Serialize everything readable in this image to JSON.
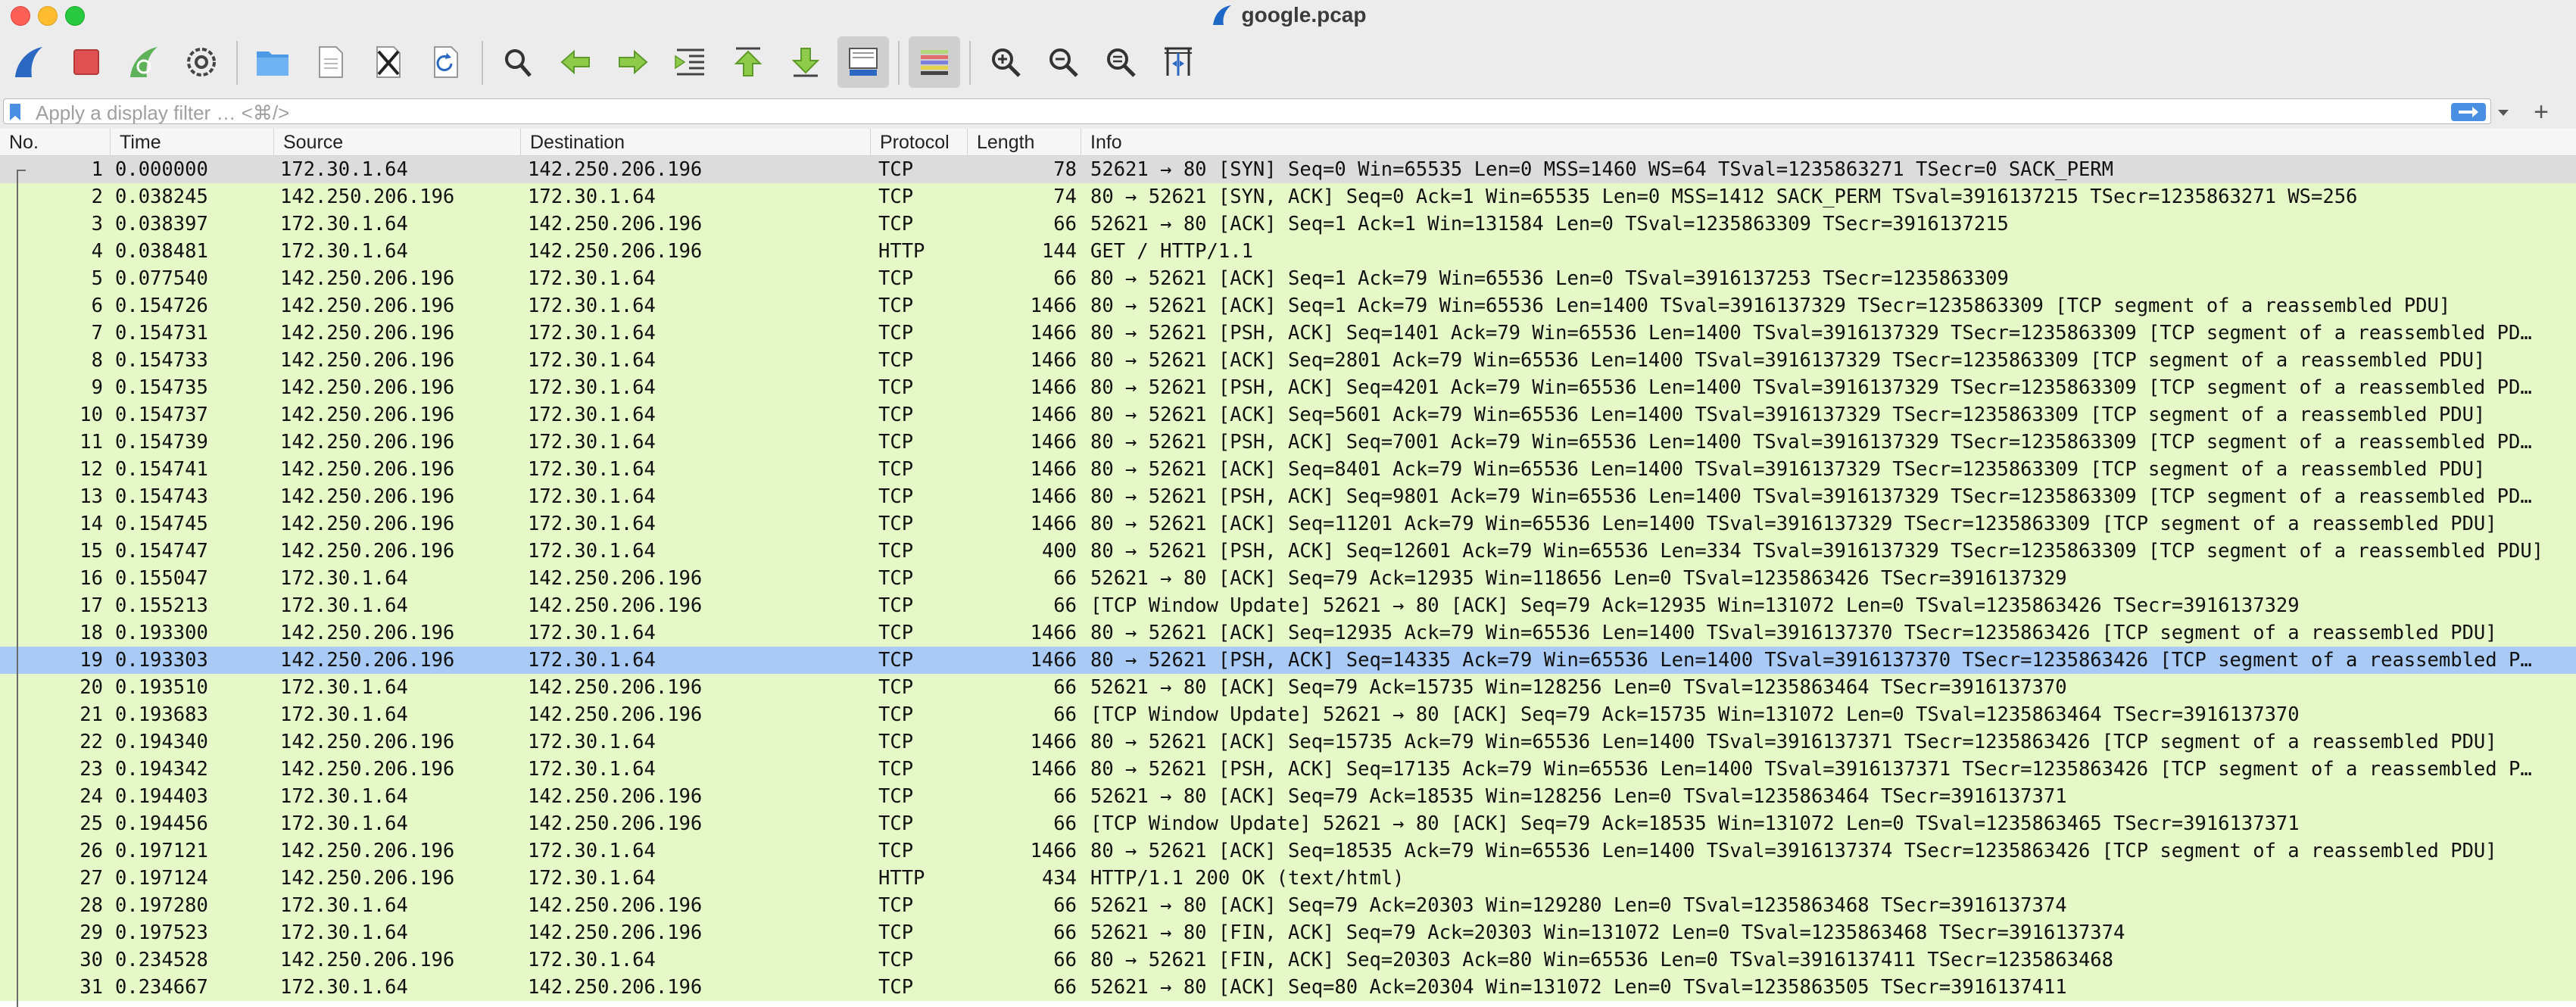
{
  "window": {
    "title": "google.pcap"
  },
  "toolbar": {
    "buttons": [
      {
        "name": "start-capture-icon"
      },
      {
        "name": "stop-capture-icon"
      },
      {
        "name": "restart-capture-icon"
      },
      {
        "name": "capture-options-icon"
      },
      {
        "name": "open-file-icon"
      },
      {
        "name": "save-file-icon"
      },
      {
        "name": "close-file-icon"
      },
      {
        "name": "reload-file-icon"
      },
      {
        "name": "find-packet-icon"
      },
      {
        "name": "go-back-icon"
      },
      {
        "name": "go-forward-icon"
      },
      {
        "name": "go-to-packet-icon"
      },
      {
        "name": "go-first-packet-icon"
      },
      {
        "name": "go-last-packet-icon"
      },
      {
        "name": "autoscroll-icon"
      },
      {
        "name": "colorize-icon"
      },
      {
        "name": "zoom-in-icon"
      },
      {
        "name": "zoom-out-icon"
      },
      {
        "name": "normal-size-icon"
      },
      {
        "name": "resize-columns-icon"
      }
    ]
  },
  "filter": {
    "placeholder": "Apply a display filter … <⌘/>"
  },
  "columns": {
    "no": "No.",
    "time": "Time",
    "source": "Source",
    "destination": "Destination",
    "protocol": "Protocol",
    "length": "Length",
    "info": "Info"
  },
  "packets": [
    {
      "no": "1",
      "time": "0.000000",
      "src": "172.30.1.64",
      "dst": "142.250.206.196",
      "proto": "TCP",
      "len": "78",
      "info": "52621 → 80 [SYN] Seq=0 Win=65535 Len=0 MSS=1460 WS=64 TSval=1235863271 TSecr=0 SACK_PERM"
    },
    {
      "no": "2",
      "time": "0.038245",
      "src": "142.250.206.196",
      "dst": "172.30.1.64",
      "proto": "TCP",
      "len": "74",
      "info": "80 → 52621 [SYN, ACK] Seq=0 Ack=1 Win=65535 Len=0 MSS=1412 SACK_PERM TSval=3916137215 TSecr=1235863271 WS=256"
    },
    {
      "no": "3",
      "time": "0.038397",
      "src": "172.30.1.64",
      "dst": "142.250.206.196",
      "proto": "TCP",
      "len": "66",
      "info": "52621 → 80 [ACK] Seq=1 Ack=1 Win=131584 Len=0 TSval=1235863309 TSecr=3916137215"
    },
    {
      "no": "4",
      "time": "0.038481",
      "src": "172.30.1.64",
      "dst": "142.250.206.196",
      "proto": "HTTP",
      "len": "144",
      "info": "GET / HTTP/1.1"
    },
    {
      "no": "5",
      "time": "0.077540",
      "src": "142.250.206.196",
      "dst": "172.30.1.64",
      "proto": "TCP",
      "len": "66",
      "info": "80 → 52621 [ACK] Seq=1 Ack=79 Win=65536 Len=0 TSval=3916137253 TSecr=1235863309"
    },
    {
      "no": "6",
      "time": "0.154726",
      "src": "142.250.206.196",
      "dst": "172.30.1.64",
      "proto": "TCP",
      "len": "1466",
      "info": "80 → 52621 [ACK] Seq=1 Ack=79 Win=65536 Len=1400 TSval=3916137329 TSecr=1235863309 [TCP segment of a reassembled PDU]"
    },
    {
      "no": "7",
      "time": "0.154731",
      "src": "142.250.206.196",
      "dst": "172.30.1.64",
      "proto": "TCP",
      "len": "1466",
      "info": "80 → 52621 [PSH, ACK] Seq=1401 Ack=79 Win=65536 Len=1400 TSval=3916137329 TSecr=1235863309 [TCP segment of a reassembled PD…"
    },
    {
      "no": "8",
      "time": "0.154733",
      "src": "142.250.206.196",
      "dst": "172.30.1.64",
      "proto": "TCP",
      "len": "1466",
      "info": "80 → 52621 [ACK] Seq=2801 Ack=79 Win=65536 Len=1400 TSval=3916137329 TSecr=1235863309 [TCP segment of a reassembled PDU]"
    },
    {
      "no": "9",
      "time": "0.154735",
      "src": "142.250.206.196",
      "dst": "172.30.1.64",
      "proto": "TCP",
      "len": "1466",
      "info": "80 → 52621 [PSH, ACK] Seq=4201 Ack=79 Win=65536 Len=1400 TSval=3916137329 TSecr=1235863309 [TCP segment of a reassembled PD…"
    },
    {
      "no": "10",
      "time": "0.154737",
      "src": "142.250.206.196",
      "dst": "172.30.1.64",
      "proto": "TCP",
      "len": "1466",
      "info": "80 → 52621 [ACK] Seq=5601 Ack=79 Win=65536 Len=1400 TSval=3916137329 TSecr=1235863309 [TCP segment of a reassembled PDU]"
    },
    {
      "no": "11",
      "time": "0.154739",
      "src": "142.250.206.196",
      "dst": "172.30.1.64",
      "proto": "TCP",
      "len": "1466",
      "info": "80 → 52621 [PSH, ACK] Seq=7001 Ack=79 Win=65536 Len=1400 TSval=3916137329 TSecr=1235863309 [TCP segment of a reassembled PD…"
    },
    {
      "no": "12",
      "time": "0.154741",
      "src": "142.250.206.196",
      "dst": "172.30.1.64",
      "proto": "TCP",
      "len": "1466",
      "info": "80 → 52621 [ACK] Seq=8401 Ack=79 Win=65536 Len=1400 TSval=3916137329 TSecr=1235863309 [TCP segment of a reassembled PDU]"
    },
    {
      "no": "13",
      "time": "0.154743",
      "src": "142.250.206.196",
      "dst": "172.30.1.64",
      "proto": "TCP",
      "len": "1466",
      "info": "80 → 52621 [PSH, ACK] Seq=9801 Ack=79 Win=65536 Len=1400 TSval=3916137329 TSecr=1235863309 [TCP segment of a reassembled PD…"
    },
    {
      "no": "14",
      "time": "0.154745",
      "src": "142.250.206.196",
      "dst": "172.30.1.64",
      "proto": "TCP",
      "len": "1466",
      "info": "80 → 52621 [ACK] Seq=11201 Ack=79 Win=65536 Len=1400 TSval=3916137329 TSecr=1235863309 [TCP segment of a reassembled PDU]"
    },
    {
      "no": "15",
      "time": "0.154747",
      "src": "142.250.206.196",
      "dst": "172.30.1.64",
      "proto": "TCP",
      "len": "400",
      "info": "80 → 52621 [PSH, ACK] Seq=12601 Ack=79 Win=65536 Len=334 TSval=3916137329 TSecr=1235863309 [TCP segment of a reassembled PDU]"
    },
    {
      "no": "16",
      "time": "0.155047",
      "src": "172.30.1.64",
      "dst": "142.250.206.196",
      "proto": "TCP",
      "len": "66",
      "info": "52621 → 80 [ACK] Seq=79 Ack=12935 Win=118656 Len=0 TSval=1235863426 TSecr=3916137329"
    },
    {
      "no": "17",
      "time": "0.155213",
      "src": "172.30.1.64",
      "dst": "142.250.206.196",
      "proto": "TCP",
      "len": "66",
      "info": "[TCP Window Update] 52621 → 80 [ACK] Seq=79 Ack=12935 Win=131072 Len=0 TSval=1235863426 TSecr=3916137329"
    },
    {
      "no": "18",
      "time": "0.193300",
      "src": "142.250.206.196",
      "dst": "172.30.1.64",
      "proto": "TCP",
      "len": "1466",
      "info": "80 → 52621 [ACK] Seq=12935 Ack=79 Win=65536 Len=1400 TSval=3916137370 TSecr=1235863426 [TCP segment of a reassembled PDU]"
    },
    {
      "no": "19",
      "time": "0.193303",
      "src": "142.250.206.196",
      "dst": "172.30.1.64",
      "proto": "TCP",
      "len": "1466",
      "info": "80 → 52621 [PSH, ACK] Seq=14335 Ack=79 Win=65536 Len=1400 TSval=3916137370 TSecr=1235863426 [TCP segment of a reassembled P…"
    },
    {
      "no": "20",
      "time": "0.193510",
      "src": "172.30.1.64",
      "dst": "142.250.206.196",
      "proto": "TCP",
      "len": "66",
      "info": "52621 → 80 [ACK] Seq=79 Ack=15735 Win=128256 Len=0 TSval=1235863464 TSecr=3916137370"
    },
    {
      "no": "21",
      "time": "0.193683",
      "src": "172.30.1.64",
      "dst": "142.250.206.196",
      "proto": "TCP",
      "len": "66",
      "info": "[TCP Window Update] 52621 → 80 [ACK] Seq=79 Ack=15735 Win=131072 Len=0 TSval=1235863464 TSecr=3916137370"
    },
    {
      "no": "22",
      "time": "0.194340",
      "src": "142.250.206.196",
      "dst": "172.30.1.64",
      "proto": "TCP",
      "len": "1466",
      "info": "80 → 52621 [ACK] Seq=15735 Ack=79 Win=65536 Len=1400 TSval=3916137371 TSecr=1235863426 [TCP segment of a reassembled PDU]"
    },
    {
      "no": "23",
      "time": "0.194342",
      "src": "142.250.206.196",
      "dst": "172.30.1.64",
      "proto": "TCP",
      "len": "1466",
      "info": "80 → 52621 [PSH, ACK] Seq=17135 Ack=79 Win=65536 Len=1400 TSval=3916137371 TSecr=1235863426 [TCP segment of a reassembled P…"
    },
    {
      "no": "24",
      "time": "0.194403",
      "src": "172.30.1.64",
      "dst": "142.250.206.196",
      "proto": "TCP",
      "len": "66",
      "info": "52621 → 80 [ACK] Seq=79 Ack=18535 Win=128256 Len=0 TSval=1235863464 TSecr=3916137371"
    },
    {
      "no": "25",
      "time": "0.194456",
      "src": "172.30.1.64",
      "dst": "142.250.206.196",
      "proto": "TCP",
      "len": "66",
      "info": "[TCP Window Update] 52621 → 80 [ACK] Seq=79 Ack=18535 Win=131072 Len=0 TSval=1235863465 TSecr=3916137371"
    },
    {
      "no": "26",
      "time": "0.197121",
      "src": "142.250.206.196",
      "dst": "172.30.1.64",
      "proto": "TCP",
      "len": "1466",
      "info": "80 → 52621 [ACK] Seq=18535 Ack=79 Win=65536 Len=1400 TSval=3916137374 TSecr=1235863426 [TCP segment of a reassembled PDU]"
    },
    {
      "no": "27",
      "time": "0.197124",
      "src": "142.250.206.196",
      "dst": "172.30.1.64",
      "proto": "HTTP",
      "len": "434",
      "info": "HTTP/1.1 200 OK  (text/html)"
    },
    {
      "no": "28",
      "time": "0.197280",
      "src": "172.30.1.64",
      "dst": "142.250.206.196",
      "proto": "TCP",
      "len": "66",
      "info": "52621 → 80 [ACK] Seq=79 Ack=20303 Win=129280 Len=0 TSval=1235863468 TSecr=3916137374"
    },
    {
      "no": "29",
      "time": "0.197523",
      "src": "172.30.1.64",
      "dst": "142.250.206.196",
      "proto": "TCP",
      "len": "66",
      "info": "52621 → 80 [FIN, ACK] Seq=79 Ack=20303 Win=131072 Len=0 TSval=1235863468 TSecr=3916137374"
    },
    {
      "no": "30",
      "time": "0.234528",
      "src": "142.250.206.196",
      "dst": "172.30.1.64",
      "proto": "TCP",
      "len": "66",
      "info": "80 → 52621 [FIN, ACK] Seq=20303 Ack=80 Win=65536 Len=0 TSval=3916137411 TSecr=1235863468"
    },
    {
      "no": "31",
      "time": "0.234667",
      "src": "172.30.1.64",
      "dst": "142.250.206.196",
      "proto": "TCP",
      "len": "66",
      "info": "52621 → 80 [ACK] Seq=80 Ack=20304 Win=131072 Len=0 TSval=1235863505 TSecr=3916137411"
    }
  ],
  "selected_packet": "19",
  "colors": {
    "tcp_row": "#e7f8c8",
    "first_row": "#dcdcdc",
    "selected_row": "#a9caf4",
    "accent": "#4a90e2"
  }
}
